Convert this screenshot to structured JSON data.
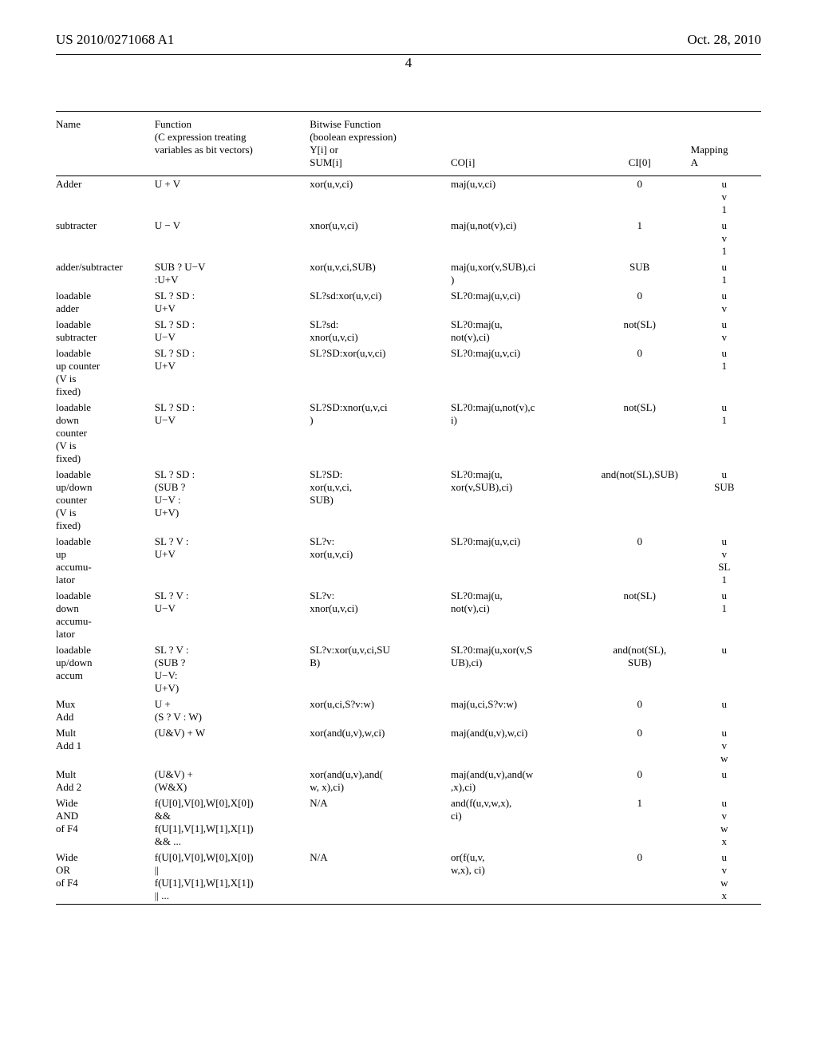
{
  "header": {
    "pub_number": "US 2010/0271068 A1",
    "date": "Oct. 28, 2010",
    "page_num": "4"
  },
  "table": {
    "columns": {
      "name": "Name",
      "func_l1": "Function",
      "func_l2": "(C expression treating",
      "func_l3": "variables as bit vectors)",
      "bit_l1": "Bitwise Function",
      "bit_l2": "(boolean expression)",
      "bit_l3": "Y[i] or",
      "bit_l4": "SUM[i]",
      "co": "CO[i]",
      "ci": "CI[0]",
      "map_l1": "Mapping",
      "map_l2": "A"
    },
    "rows": [
      {
        "name": "Adder",
        "func": "U + V",
        "sum": "xor(u,v,ci)",
        "co": "maj(u,v,ci)",
        "ci": "0",
        "map": "u\nv\n1"
      },
      {
        "name": "subtracter",
        "func": "U − V",
        "sum": "xnor(u,v,ci)",
        "co": "maj(u,not(v),ci)",
        "ci": "1",
        "map": "u\nv\n1"
      },
      {
        "name": "adder/subtracter",
        "func": "SUB ? U−V\n:U+V",
        "sum": "xor(u,v,ci,SUB)",
        "co": "maj(u,xor(v,SUB),ci\n)",
        "ci": "SUB",
        "map": "u\n1"
      },
      {
        "name": "loadable\nadder",
        "func": "SL ? SD :\nU+V",
        "sum": "SL?sd:xor(u,v,ci)",
        "co": "SL?0:maj(u,v,ci)",
        "ci": "0",
        "map": "u\nv"
      },
      {
        "name": "loadable\nsubtracter",
        "func": "SL ? SD :\nU−V",
        "sum": "SL?sd:\nxnor(u,v,ci)",
        "co": "SL?0:maj(u,\nnot(v),ci)",
        "ci": "not(SL)",
        "map": "u\nv"
      },
      {
        "name": "loadable\nup counter\n(V is\nfixed)",
        "func": "SL ? SD :\nU+V",
        "sum": "SL?SD:xor(u,v,ci)",
        "co": "SL?0:maj(u,v,ci)",
        "ci": "0",
        "map": "u\n1"
      },
      {
        "name": "loadable\ndown\ncounter\n(V is\nfixed)",
        "func": "SL ? SD :\nU−V",
        "sum": "SL?SD:xnor(u,v,ci\n)",
        "co": "SL?0:maj(u,not(v),c\ni)",
        "ci": "not(SL)",
        "map": "u\n1"
      },
      {
        "name": "loadable\nup/down\ncounter\n(V is\nfixed)",
        "func": "SL ? SD :\n(SUB ?\nU−V :\nU+V)",
        "sum": "SL?SD:\nxor(u,v,ci,\nSUB)",
        "co": "SL?0:maj(u,\nxor(v,SUB),ci)",
        "ci": "and(not(SL),SUB)",
        "map": "u\nSUB"
      },
      {
        "name": "loadable\nup\naccumu-\nlator",
        "func": "SL ? V :\nU+V",
        "sum": "SL?v:\nxor(u,v,ci)",
        "co": "SL?0:maj(u,v,ci)",
        "ci": "0",
        "map": "u\nv\nSL\n1"
      },
      {
        "name": "loadable\ndown\naccumu-\nlator",
        "func": "SL ? V :\nU−V",
        "sum": "SL?v:\nxnor(u,v,ci)",
        "co": "SL?0:maj(u,\nnot(v),ci)",
        "ci": "not(SL)",
        "map": "u\n1"
      },
      {
        "name": "loadable\nup/down\naccum",
        "func": "SL ? V :\n(SUB ?\nU−V:\nU+V)",
        "sum": "SL?v:xor(u,v,ci,SU\nB)",
        "co": "SL?0:maj(u,xor(v,S\nUB),ci)",
        "ci": "and(not(SL),\nSUB)",
        "map": "u"
      },
      {
        "name": "Mux\nAdd",
        "func": "U +\n(S ? V : W)",
        "sum": "xor(u,ci,S?v:w)",
        "co": "maj(u,ci,S?v:w)",
        "ci": "0",
        "map": "u"
      },
      {
        "name": "Mult\nAdd 1",
        "func": "(U&V) + W",
        "sum": "xor(and(u,v),w,ci)",
        "co": "maj(and(u,v),w,ci)",
        "ci": "0",
        "map": "u\nv\nw"
      },
      {
        "name": "Mult\nAdd 2",
        "func": "(U&V) +\n(W&X)",
        "sum": "xor(and(u,v),and(\nw, x),ci)",
        "co": "maj(and(u,v),and(w\n,x),ci)",
        "ci": "0",
        "map": "u"
      },
      {
        "name": "Wide\nAND\nof F4",
        "func": "f(U[0],V[0],W[0],X[0])\n&&\nf(U[1],V[1],W[1],X[1])\n&& ...",
        "sum": "N/A",
        "co": "and(f(u,v,w,x),\nci)",
        "ci": "1",
        "map": "u\nv\nw\nx"
      },
      {
        "name": "Wide\nOR\nof F4",
        "func": "f(U[0],V[0],W[0],X[0])\n||\nf(U[1],V[1],W[1],X[1])\n|| ...",
        "sum": "N/A",
        "co": "or(f(u,v,\nw,x), ci)",
        "ci": "0",
        "map": "u\nv\nw\nx"
      }
    ]
  }
}
